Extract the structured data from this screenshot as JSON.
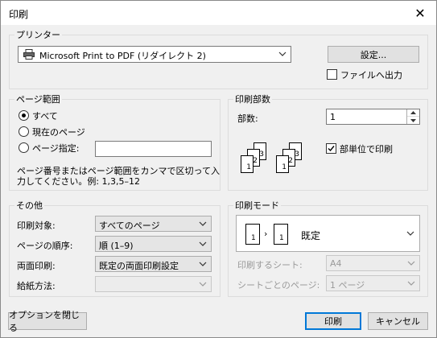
{
  "window": {
    "title": "印刷",
    "close_glyph": "✕"
  },
  "printer": {
    "legend": "プリンター",
    "selected": "Microsoft Print to PDF (リダイレクト 2)",
    "settings_label": "設定...",
    "print_to_file_label": "ファイルへ出力",
    "print_to_file_checked": false,
    "icon": "printer-icon"
  },
  "range": {
    "legend": "ページ範囲",
    "all_label": "すべて",
    "current_label": "現在のページ",
    "pages_label": "ページ指定:",
    "pages_value": "",
    "selected": "all",
    "hint": "ページ番号またはページ範囲をカンマで区切って入力してください。例: 1,3,5–12",
    "hint_line1": "ページ番号またはページ範囲をカンマで区切って入",
    "hint_line2": "力してください。例: 1,3,5–12"
  },
  "copies": {
    "legend": "印刷部数",
    "count_label": "部数:",
    "count_value": "1",
    "collate_label": "部単位で印刷",
    "collate_checked": true,
    "collate_page_numbers": [
      "3",
      "2",
      "1",
      "3",
      "2",
      "1"
    ]
  },
  "other": {
    "legend": "その他",
    "target_label": "印刷対象:",
    "target_value": "すべてのページ",
    "order_label": "ページの順序:",
    "order_value": "順 (1–9)",
    "duplex_label": "両面印刷:",
    "duplex_value": "既定の両面印刷設定",
    "paper_label": "給紙方法:",
    "paper_value": ""
  },
  "mode": {
    "legend": "印刷モード",
    "value": "既定",
    "page_from": "1",
    "page_to": "1",
    "sheets_label": "印刷するシート:",
    "sheets_value": "A4",
    "pages_per_sheet_label": "シートごとのページ:",
    "pages_per_sheet_value": "1 ページ"
  },
  "footer": {
    "close_options_label": "オプションを閉じる",
    "print_label": "印刷",
    "cancel_label": "キャンセル"
  }
}
